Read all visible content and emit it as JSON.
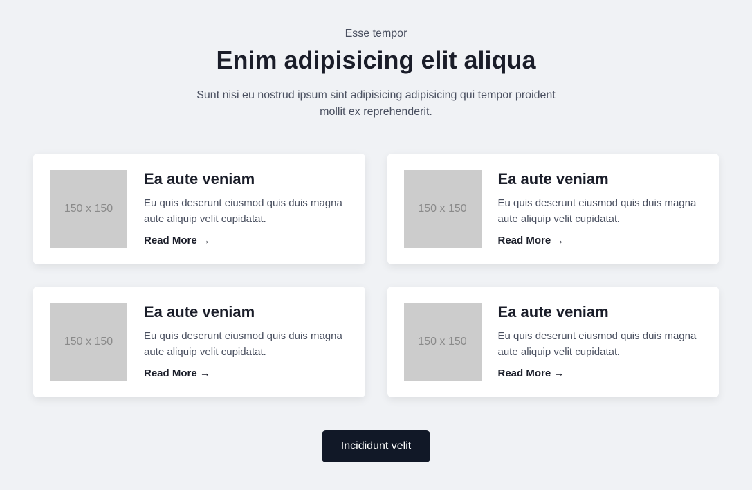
{
  "header": {
    "pretitle": "Esse tempor",
    "title": "Enim adipisicing elit aliqua",
    "subtitle": "Sunt nisi eu nostrud ipsum sint adipisicing adipisicing qui tempor proident mollit ex reprehenderit."
  },
  "cards": [
    {
      "image_placeholder": "150 x 150",
      "title": "Ea aute veniam",
      "description": "Eu quis deserunt eiusmod quis duis magna aute aliquip velit cupidatat.",
      "link_text": "Read More →"
    },
    {
      "image_placeholder": "150 x 150",
      "title": "Ea aute veniam",
      "description": "Eu quis deserunt eiusmod quis duis magna aute aliquip velit cupidatat.",
      "link_text": "Read More →"
    },
    {
      "image_placeholder": "150 x 150",
      "title": "Ea aute veniam",
      "description": "Eu quis deserunt eiusmod quis duis magna aute aliquip velit cupidatat.",
      "link_text": "Read More →"
    },
    {
      "image_placeholder": "150 x 150",
      "title": "Ea aute veniam",
      "description": "Eu quis deserunt eiusmod quis duis magna aute aliquip velit cupidatat.",
      "link_text": "Read More →"
    }
  ],
  "cta": {
    "label": "Incididunt velit"
  }
}
